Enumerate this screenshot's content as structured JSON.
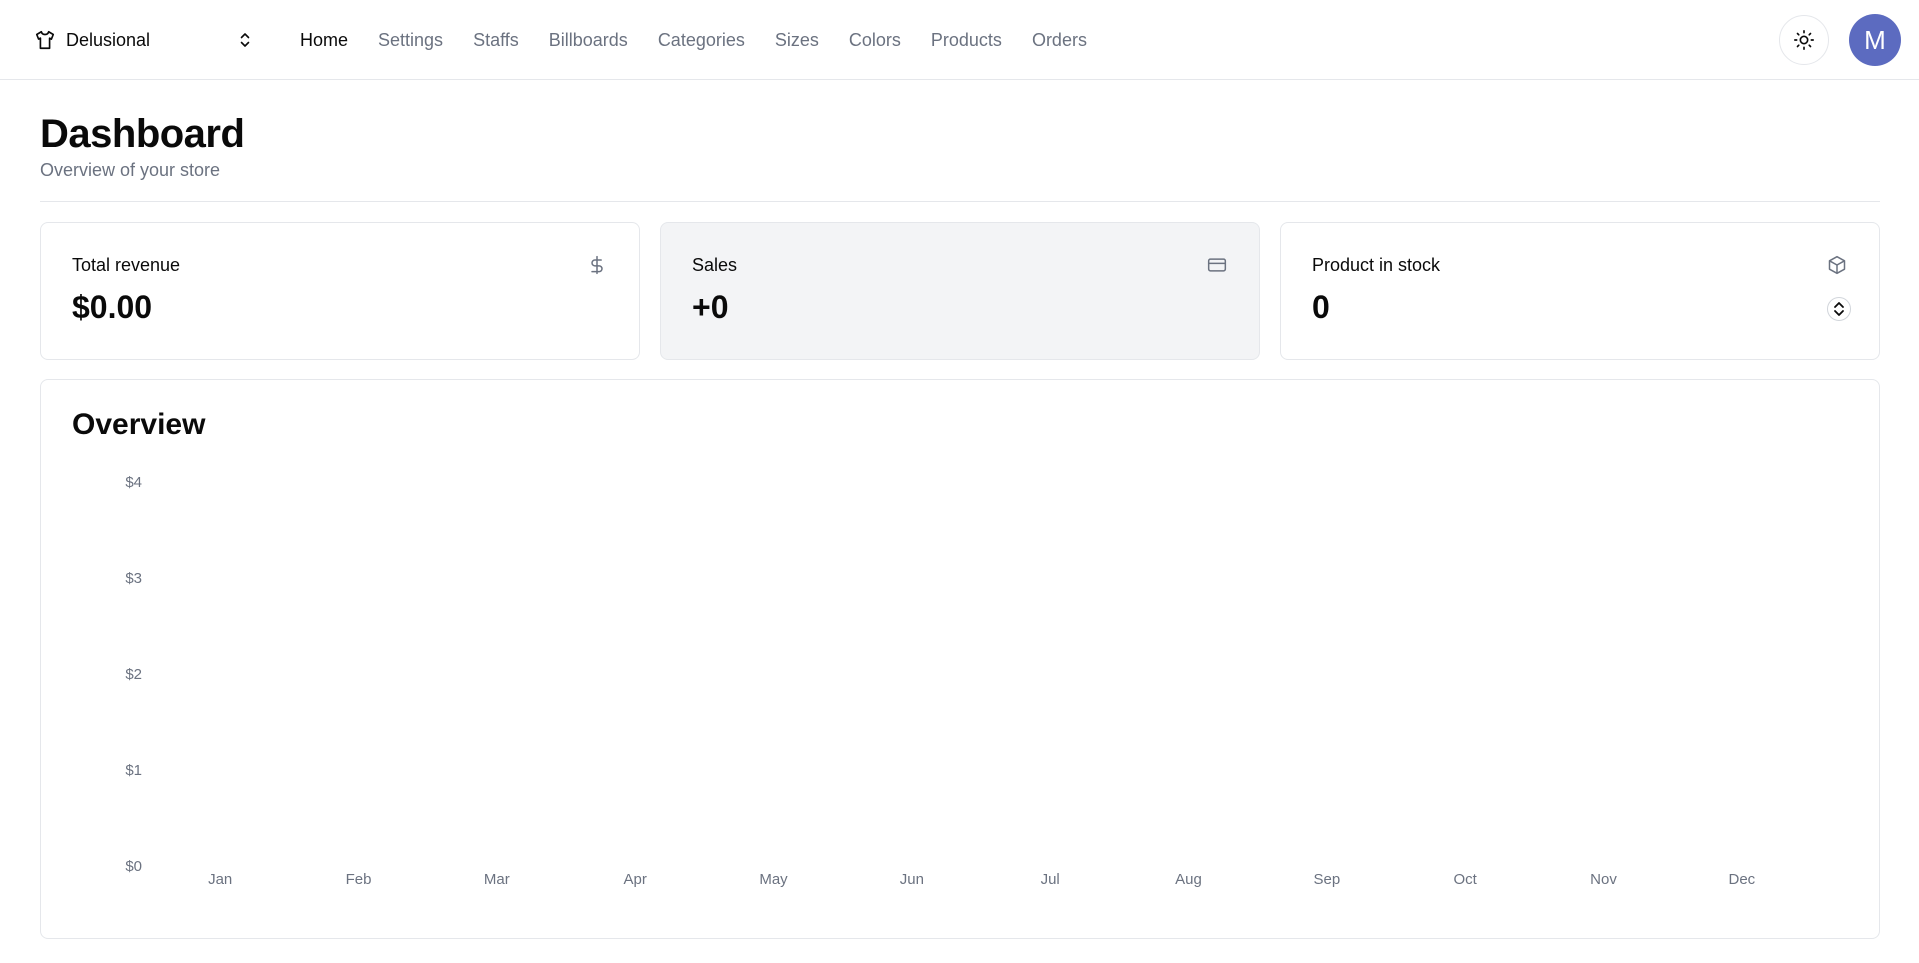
{
  "store": {
    "name": "Delusional",
    "icon": "shirt-icon"
  },
  "nav": {
    "items": [
      {
        "label": "Home",
        "active": true
      },
      {
        "label": "Settings",
        "active": false
      },
      {
        "label": "Staffs",
        "active": false
      },
      {
        "label": "Billboards",
        "active": false
      },
      {
        "label": "Categories",
        "active": false
      },
      {
        "label": "Sizes",
        "active": false
      },
      {
        "label": "Colors",
        "active": false
      },
      {
        "label": "Products",
        "active": false
      },
      {
        "label": "Orders",
        "active": false
      }
    ]
  },
  "user": {
    "avatar_initial": "M",
    "avatar_color": "#5c6bc0"
  },
  "page": {
    "title": "Dashboard",
    "subtitle": "Overview of your store"
  },
  "cards": [
    {
      "label": "Total revenue",
      "value": "$0.00",
      "icon": "dollar-sign-icon"
    },
    {
      "label": "Sales",
      "value": "+0",
      "icon": "credit-card-icon"
    },
    {
      "label": "Product in stock",
      "value": "0",
      "icon": "package-icon"
    }
  ],
  "overview": {
    "title": "Overview"
  },
  "chart_data": {
    "type": "bar",
    "categories": [
      "Jan",
      "Feb",
      "Mar",
      "Apr",
      "May",
      "Jun",
      "Jul",
      "Aug",
      "Sep",
      "Oct",
      "Nov",
      "Dec"
    ],
    "values": [
      0,
      0,
      0,
      0,
      0,
      0,
      0,
      0,
      0,
      0,
      0,
      0
    ],
    "y_ticks": [
      "$0",
      "$1",
      "$2",
      "$3",
      "$4"
    ],
    "ylim": [
      0,
      4
    ],
    "grid": false,
    "title": "",
    "xlabel": "",
    "ylabel": ""
  }
}
